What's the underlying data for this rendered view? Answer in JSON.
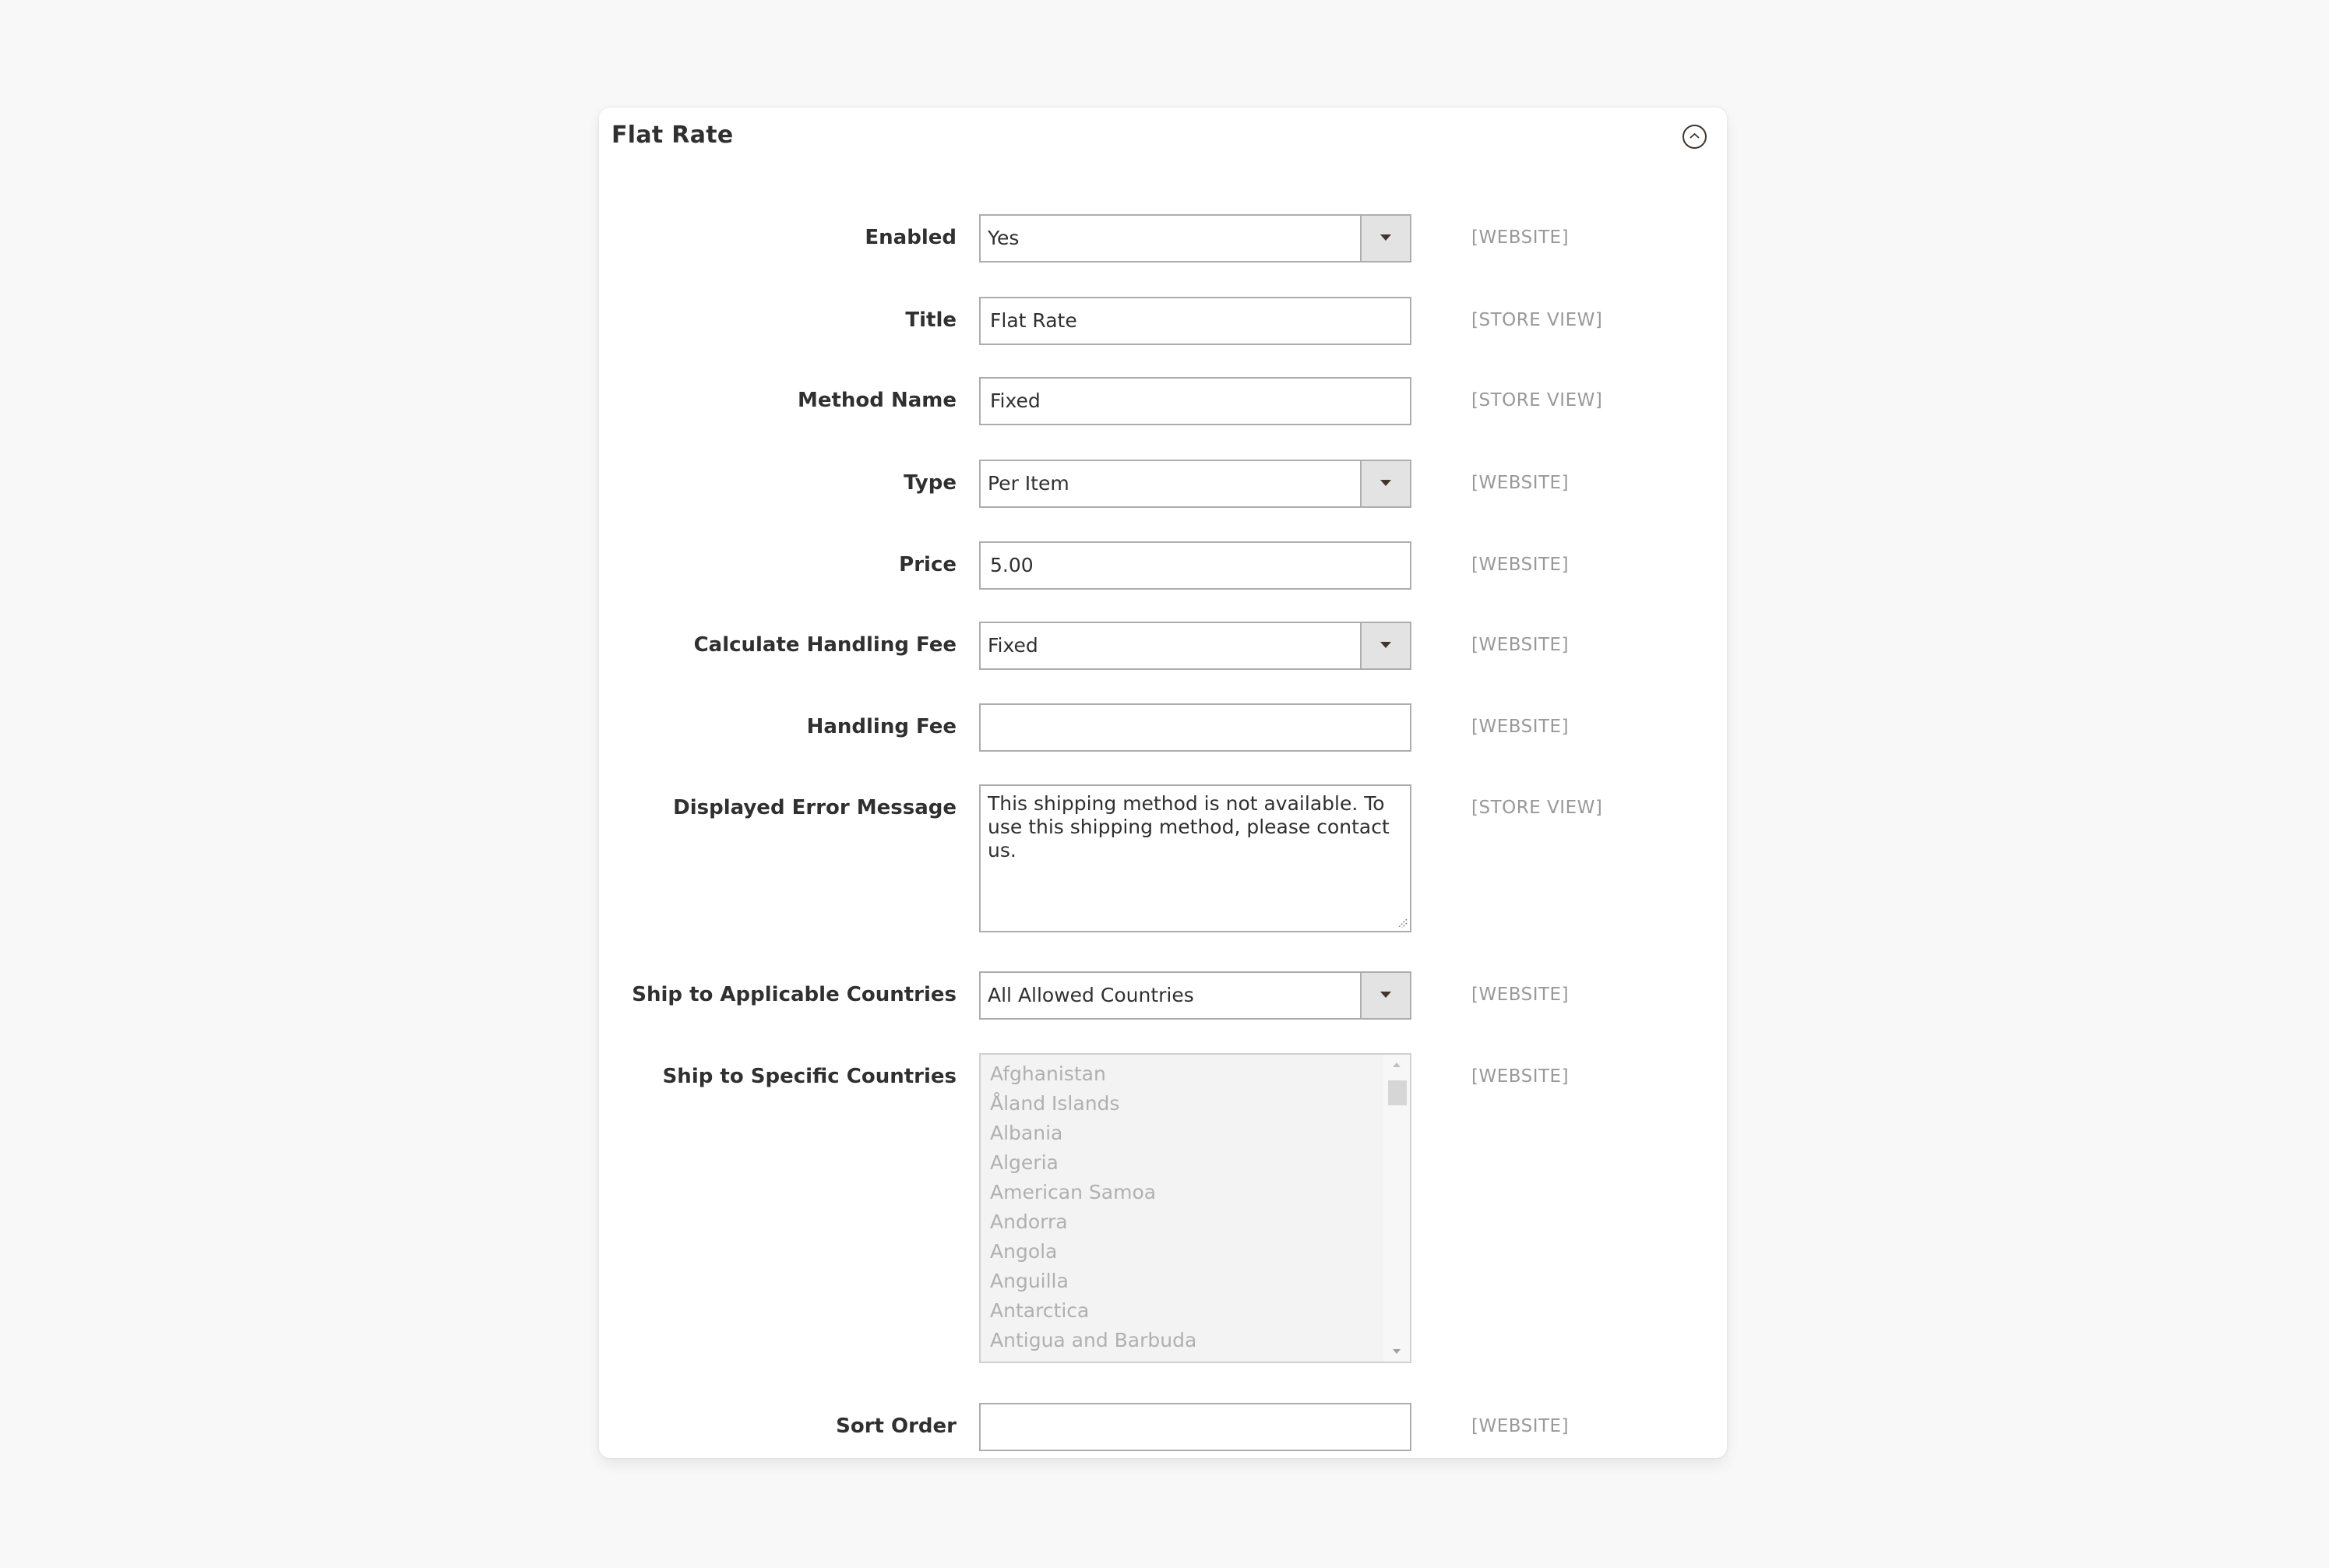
{
  "panel": {
    "title": "Flat Rate",
    "collapse_icon": "chevron-up-circle-icon"
  },
  "fields": {
    "enabled": {
      "label": "Enabled",
      "value": "Yes",
      "scope": "[WEBSITE]"
    },
    "title": {
      "label": "Title",
      "value": "Flat Rate",
      "scope": "[STORE VIEW]"
    },
    "method_name": {
      "label": "Method Name",
      "value": "Fixed",
      "scope": "[STORE VIEW]"
    },
    "type": {
      "label": "Type",
      "value": "Per Item",
      "scope": "[WEBSITE]"
    },
    "price": {
      "label": "Price",
      "value": "5.00",
      "scope": "[WEBSITE]"
    },
    "calc_handling_fee": {
      "label": "Calculate Handling Fee",
      "value": "Fixed",
      "scope": "[WEBSITE]"
    },
    "handling_fee": {
      "label": "Handling Fee",
      "value": "",
      "scope": "[WEBSITE]"
    },
    "error_message": {
      "label": "Displayed Error Message",
      "value": "This shipping method is not available. To use this shipping method, please contact us.",
      "scope": "[STORE VIEW]"
    },
    "ship_applicable": {
      "label": "Ship to Applicable Countries",
      "value": "All Allowed Countries",
      "scope": "[WEBSITE]"
    },
    "ship_specific": {
      "label": "Ship to Specific Countries",
      "scope": "[WEBSITE]",
      "disabled": true,
      "options": [
        "Afghanistan",
        "Åland Islands",
        "Albania",
        "Algeria",
        "American Samoa",
        "Andorra",
        "Angola",
        "Anguilla",
        "Antarctica",
        "Antigua and Barbuda"
      ]
    },
    "sort_order": {
      "label": "Sort Order",
      "value": "",
      "scope": "[WEBSITE]"
    }
  }
}
